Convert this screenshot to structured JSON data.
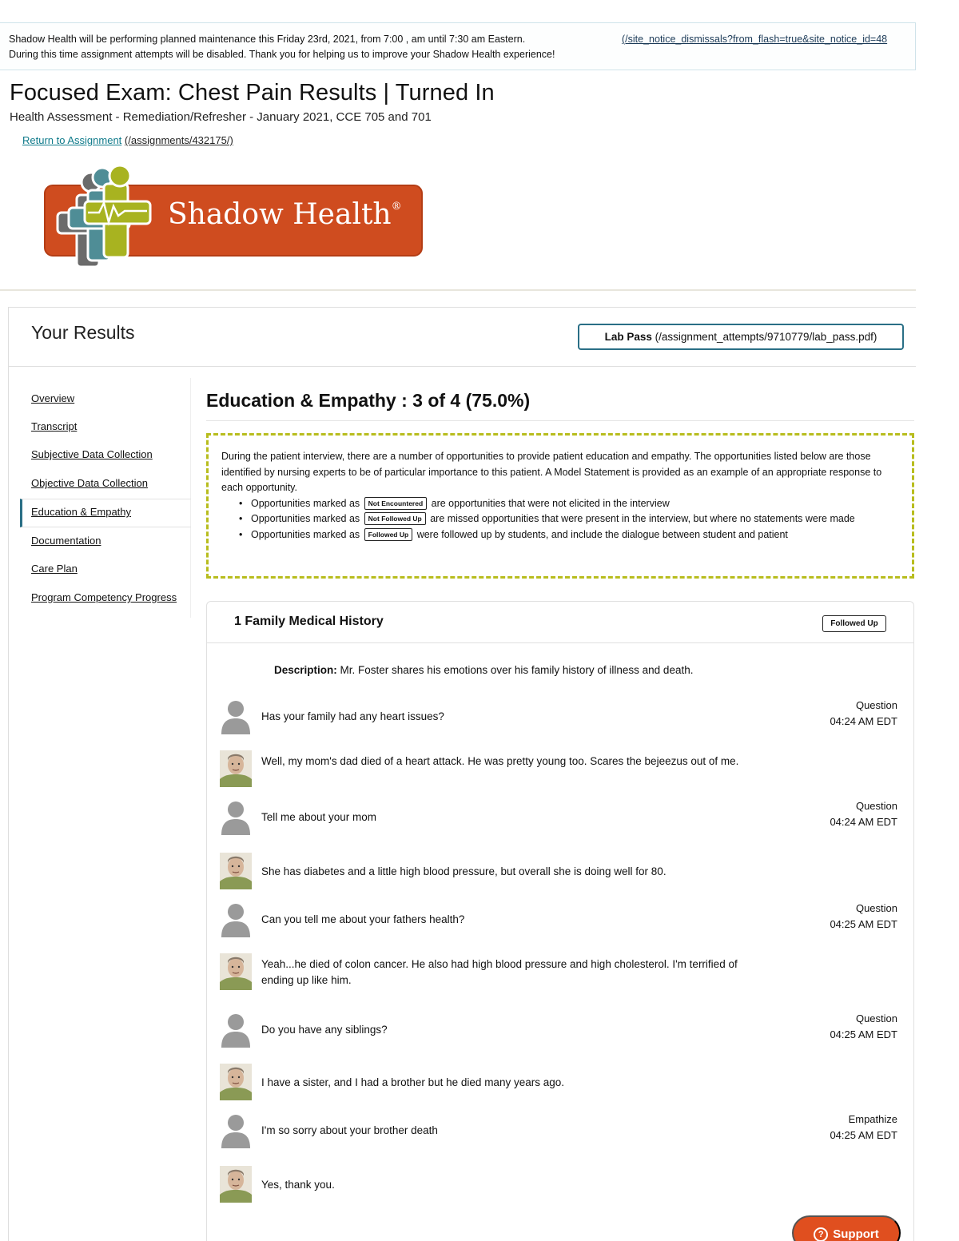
{
  "notice": {
    "line1": "Shadow Health will be performing planned maintenance this Friday 23rd, 2021, from 7:00 , am until 7:30 am Eastern.",
    "line2": "During this time assignment attempts will be disabled. Thank you for helping us to improve your Shadow Health experience!",
    "dismiss_link": "(/site_notice_dismissals?from_flash=true&site_notice_id=48"
  },
  "header": {
    "title": "Focused Exam: Chest Pain Results | Turned In",
    "subtitle": "Health Assessment - Remediation/Refresher - January 2021, CCE 705 and 701",
    "return_label": "Return to Assignment",
    "return_path": "(/assignments/432175/)"
  },
  "logo": {
    "text": "Shadow Health",
    "mark": "®",
    "icon": "shadow-health-logo-icon"
  },
  "results": {
    "title": "Your Results",
    "lab_pass_label": "Lab Pass",
    "lab_pass_path": "(/assignment_attempts/9710779/lab_pass.pdf)"
  },
  "sidebar": {
    "items": [
      {
        "label": "Overview"
      },
      {
        "label": "Transcript"
      },
      {
        "label": "Subjective Data Collection"
      },
      {
        "label": "Objective Data Collection"
      },
      {
        "label": "Education & Empathy",
        "active": true
      },
      {
        "label": "Documentation"
      },
      {
        "label": "Care Plan"
      },
      {
        "label": "Program Competency Progress"
      }
    ]
  },
  "section": {
    "title": "Education & Empathy : 3 of 4 (75.0%)"
  },
  "info": {
    "paragraph": "During the patient interview, there are a number of opportunities to provide patient education and empathy. The opportunities listed below are those identified by nursing experts to be of particular importance to this patient. A Model Statement is provided as an example of an appropriate response to each opportunity.",
    "prefix": "Opportunities marked as",
    "bullets": [
      {
        "chip": "Not Encountered",
        "text": "are opportunities that were not elicited in the interview"
      },
      {
        "chip": "Not Followed Up",
        "text": "are missed opportunities that were present in the interview, but where no statements were made"
      },
      {
        "chip": "Followed Up",
        "text": "were followed up by students, and include the dialogue between student and patient"
      }
    ]
  },
  "panel": {
    "title": "1 Family Medical History",
    "status": "Followed Up",
    "description_label": "Description:",
    "description_text": "Mr. Foster shares his emotions over his family history of illness and death.",
    "messages": [
      {
        "role": "student",
        "text": "Has your family had any heart issues?",
        "type": "Question",
        "time": "04:24 AM EDT"
      },
      {
        "role": "patient",
        "text": "Well, my mom's dad died of a heart attack. He was pretty young too. Scares the bejeezus out of me."
      },
      {
        "role": "student",
        "text": "Tell me about your mom",
        "type": "Question",
        "time": "04:24 AM EDT"
      },
      {
        "role": "patient",
        "text": "She has diabetes and a little high blood pressure, but overall she is doing well for 80."
      },
      {
        "role": "student",
        "text": "Can you tell me about your fathers health?",
        "type": "Question",
        "time": "04:25 AM EDT"
      },
      {
        "role": "patient",
        "text": "Yeah...he died of colon cancer. He also had high blood pressure and high cholesterol. I'm terrified of ending up like him."
      },
      {
        "role": "student",
        "text": "Do you have any siblings?",
        "type": "Question",
        "time": "04:25 AM EDT"
      },
      {
        "role": "patient",
        "text": "I have a sister, and I had a brother but he died many years ago."
      },
      {
        "role": "student",
        "text": "I'm so sorry about your brother death",
        "type": "Empathize",
        "time": "04:25 AM EDT"
      },
      {
        "role": "patient",
        "text": "Yes, thank you."
      }
    ]
  },
  "support": {
    "label": "Support",
    "icon": "question-circle-icon"
  },
  "colors": {
    "accent": "#2a6f86",
    "link": "#0e7a8a",
    "info_border": "#b8bd1e",
    "support": "#e04f1f",
    "logo_orange": "#d4501f",
    "logo_green": "#a8b320"
  }
}
